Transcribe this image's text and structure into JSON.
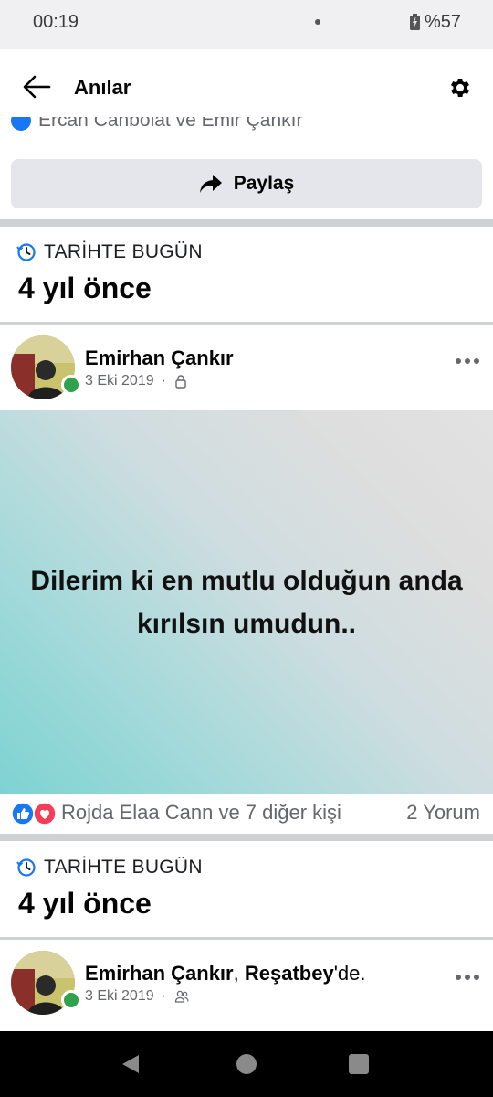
{
  "status_bar": {
    "time": "00:19",
    "battery": "%57"
  },
  "header": {
    "title": "Anılar"
  },
  "clipped_row": {
    "text": "Ercan Canbolat ve Emir Çankır"
  },
  "share": {
    "label": "Paylaş"
  },
  "sections": [
    {
      "on_this_day": "TARİHTE BUGÜN",
      "years_ago": "4 yıl önce",
      "post": {
        "author": "Emirhan Çankır",
        "date": "3 Eki 2019",
        "separator": "·",
        "privacy_icon": "lock-icon",
        "text": "Dilerim ki en mutlu olduğun anda kırılsın umudun..",
        "reactions": "Rojda Elaa Cann ve 7 diğer kişi",
        "comments": "2 Yorum"
      }
    },
    {
      "on_this_day": "TARİHTE BUGÜN",
      "years_ago": "4 yıl önce",
      "post": {
        "author": "Emirhan Çankır",
        "place_prefix": ", ",
        "place": "Reşatbey",
        "place_suffix": "'de.",
        "date": "3 Eki 2019",
        "separator": "·",
        "privacy_icon": "friends-icon"
      }
    }
  ],
  "colors": {
    "accent": "#1877f2",
    "online": "#31a24c",
    "heart": "#f33e58"
  }
}
